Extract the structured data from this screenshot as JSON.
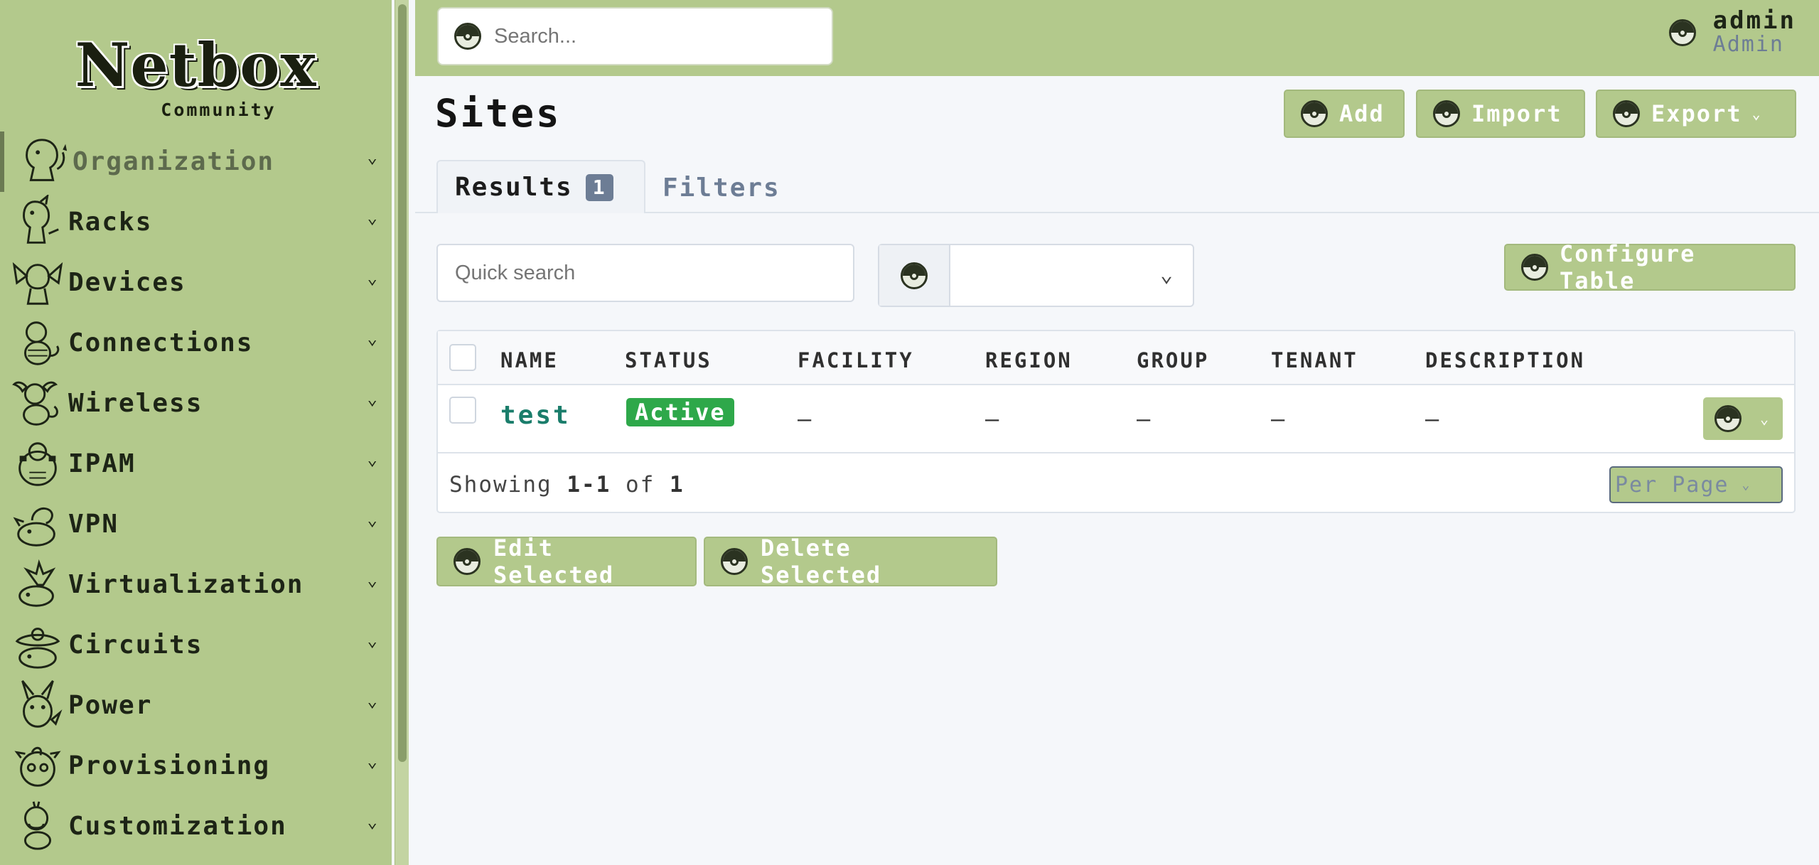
{
  "brand": {
    "name": "Netbox",
    "edition": "Community"
  },
  "sidebar": {
    "items": [
      {
        "label": "Organization",
        "icon": "charmander-icon",
        "active": true
      },
      {
        "label": "Racks",
        "icon": "charmeleon-icon"
      },
      {
        "label": "Devices",
        "icon": "charizard-icon"
      },
      {
        "label": "Connections",
        "icon": "squirtle-icon"
      },
      {
        "label": "Wireless",
        "icon": "wartortle-icon"
      },
      {
        "label": "IPAM",
        "icon": "blastoise-icon"
      },
      {
        "label": "VPN",
        "icon": "bulbasaur-icon"
      },
      {
        "label": "Virtualization",
        "icon": "ivysaur-icon"
      },
      {
        "label": "Circuits",
        "icon": "venusaur-icon"
      },
      {
        "label": "Power",
        "icon": "pikachu-icon"
      },
      {
        "label": "Provisioning",
        "icon": "jigglypuff-icon"
      },
      {
        "label": "Customization",
        "icon": "psyduck-icon"
      }
    ]
  },
  "topbar": {
    "search_placeholder": "Search...",
    "user": {
      "name": "admin",
      "role": "Admin"
    }
  },
  "page": {
    "title": "Sites",
    "actions": {
      "add": "Add",
      "import": "Import",
      "export": "Export"
    }
  },
  "tabs": {
    "results": {
      "label": "Results",
      "count": "1"
    },
    "filters": {
      "label": "Filters"
    }
  },
  "controls": {
    "quick_search_placeholder": "Quick search",
    "configure_table": "Configure Table"
  },
  "table": {
    "columns": [
      "NAME",
      "STATUS",
      "FACILITY",
      "REGION",
      "GROUP",
      "TENANT",
      "DESCRIPTION"
    ],
    "rows": [
      {
        "name": "test",
        "status": "Active",
        "facility": "—",
        "region": "—",
        "group": "—",
        "tenant": "—",
        "description": "—"
      }
    ],
    "footer": {
      "prefix": "Showing ",
      "range": "1-1",
      "of": " of ",
      "total": "1"
    },
    "per_page": "Per Page"
  },
  "bulk": {
    "edit": "Edit Selected",
    "delete": "Delete Selected"
  },
  "colors": {
    "theme_green": "#b3c98c",
    "status_active": "#2ea84a",
    "link_teal": "#1a7d6b",
    "muted_slate": "#6d7d95"
  }
}
